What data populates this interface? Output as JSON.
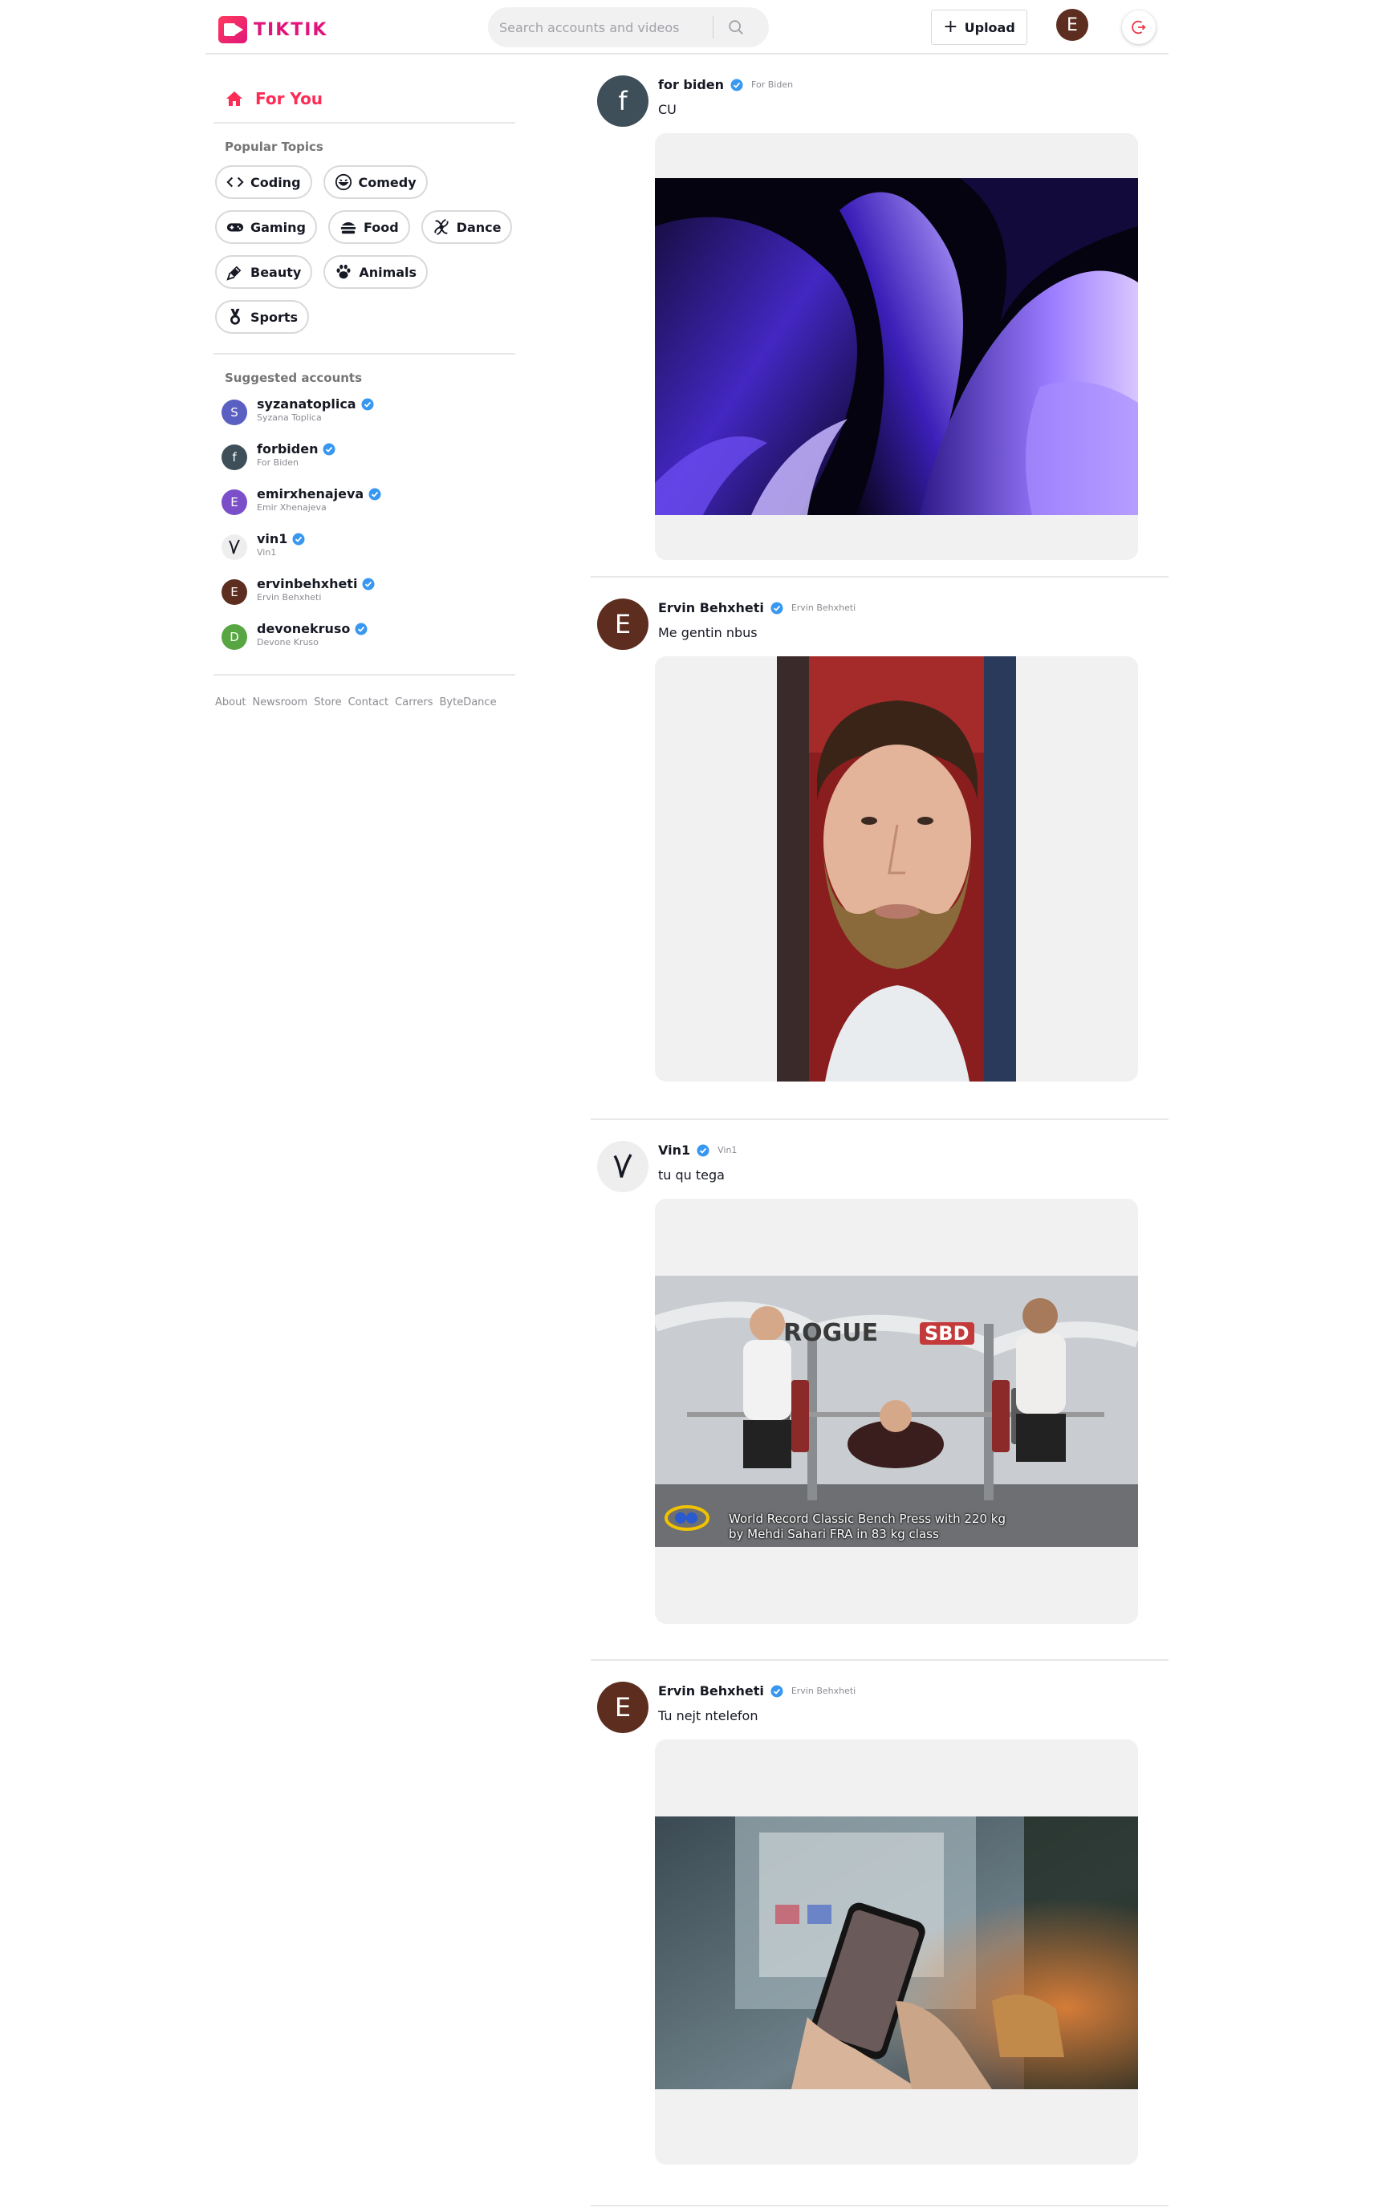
{
  "header": {
    "logo_text": "TIKTIK",
    "search_placeholder": "Search accounts and videos",
    "upload_label": "Upload",
    "user_initial": "E"
  },
  "sidebar": {
    "for_you": "For You",
    "topics_title": "Popular Topics",
    "topics": [
      {
        "label": "Coding",
        "icon": "code-icon"
      },
      {
        "label": "Comedy",
        "icon": "laugh-emoji-icon"
      },
      {
        "label": "Gaming",
        "icon": "gamepad-icon"
      },
      {
        "label": "Food",
        "icon": "burger-icon"
      },
      {
        "label": "Dance",
        "icon": "dance-icon"
      },
      {
        "label": "Beauty",
        "icon": "lipstick-icon"
      },
      {
        "label": "Animals",
        "icon": "paw-icon"
      },
      {
        "label": "Sports",
        "icon": "medal-icon"
      }
    ],
    "suggested_title": "Suggested accounts",
    "accounts": [
      {
        "username": "syzanatoplica",
        "name": "Syzana Toplica",
        "initial": "S",
        "color": "#5a5fc2"
      },
      {
        "username": "forbiden",
        "name": "For Biden",
        "initial": "f",
        "color": "#3e4f59"
      },
      {
        "username": "emirxhenajeva",
        "name": "Emir Xhenajeva",
        "initial": "E",
        "color": "#7b4fc9"
      },
      {
        "username": "vin1",
        "name": "Vin1",
        "initial": "V",
        "color": "#eeeeee"
      },
      {
        "username": "ervinbehxheti",
        "name": "Ervin Behxheti",
        "initial": "E",
        "color": "#5d2e20"
      },
      {
        "username": "devonekruso",
        "name": "Devone Kruso",
        "initial": "D",
        "color": "#57a642"
      }
    ],
    "footer": [
      "About",
      "Newsroom",
      "Store",
      "Contact",
      "Carrers",
      "ByteDance"
    ]
  },
  "feed": {
    "posts": [
      {
        "username": "for biden",
        "nickname": "For Biden",
        "caption": "CU",
        "initial": "f",
        "color": "#3e4f59",
        "media": "abstract-purple-video"
      },
      {
        "username": "Ervin Behxheti",
        "nickname": "Ervin Behxheti",
        "caption": "Me gentin nbus",
        "initial": "E",
        "color": "#5d2e20",
        "media": "selfie-video"
      },
      {
        "username": "Vin1",
        "nickname": "Vin1",
        "caption": "tu qu tega",
        "initial": "V",
        "color": "#eeeeee",
        "media": "bench-press-video",
        "overlay": {
          "line1": "World Record Classic Bench Press with 220 kg",
          "line2": "by Mehdi Sahari FRA in 83 kg class",
          "banner1": "ROGUE",
          "banner2": "SBD"
        }
      },
      {
        "username": "Ervin Behxheti",
        "nickname": "Ervin Behxheti",
        "caption": "Tu nejt ntelefon",
        "initial": "E",
        "color": "#5d2e20",
        "media": "phone-video"
      }
    ]
  },
  "colors": {
    "accent": "#fe2c55",
    "brand": "#e0157a",
    "verified": "#20d5ec"
  }
}
